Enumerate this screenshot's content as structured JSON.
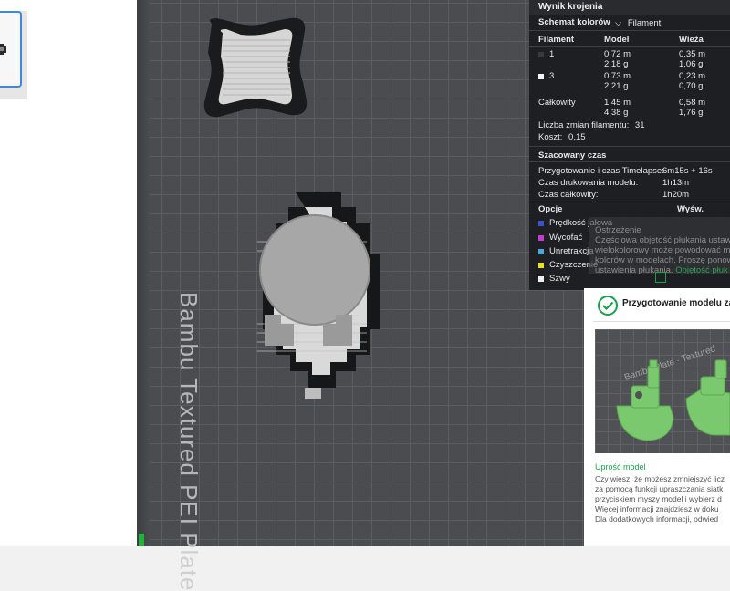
{
  "plate": {
    "label": "Bambu Textured PEI Plate"
  },
  "slice_panel": {
    "title": "Wynik krojenia",
    "color_scheme_label": "Schemat kolorów",
    "color_scheme_value": "Filament",
    "columns": [
      "Filament",
      "Model",
      "Wieża"
    ],
    "filaments": [
      {
        "id": "1",
        "color": "#3a3a3a",
        "model_m": "0,72 m",
        "model_g": "2,18 g",
        "tower_m": "0,35 m",
        "tower_g": "1,06 g"
      },
      {
        "id": "3",
        "color": "#f4f4f4",
        "model_m": "0,73 m",
        "model_g": "2,21 g",
        "tower_m": "0,23 m",
        "tower_g": "0,70 g"
      }
    ],
    "total": {
      "label": "Całkowity",
      "model_m": "1,45 m",
      "model_g": "4,38 g",
      "tower_m": "0,58 m",
      "tower_g": "1,76 g"
    },
    "filament_changes_label": "Liczba zmian filamentu:",
    "filament_changes_value": "31",
    "cost_label": "Koszt:",
    "cost_value": "0,15",
    "time_section": "Szacowany czas",
    "prep_label": "Przygotowanie i czas Timelapse:",
    "prep_value": "6m15s + 16s",
    "print_label": "Czas drukowania modelu:",
    "print_value": "1h13m",
    "total_time_label": "Czas całkowity:",
    "total_time_value": "1h20m",
    "options_label": "Opcje",
    "display_label": "Wyśw.",
    "options": [
      {
        "label": "Prędkość jałowa",
        "color": "#3a52c9"
      },
      {
        "label": "Wycofać",
        "color": "#c43bd1"
      },
      {
        "label": "Unretrakcja",
        "color": "#4aa8d8"
      },
      {
        "label": "Czyszczenie",
        "color": "#e6e02a"
      },
      {
        "label": "Szwy",
        "color": "#eeeeee"
      }
    ]
  },
  "warning": {
    "title": "Ostrzeżenie",
    "lines": [
      "Częściowa objętość płukania ustawio",
      "wielokolorowy może powodować m",
      "kolorów w modelach. Proszę ponow",
      "ustawienia płukania."
    ],
    "link": "Objętość płuk"
  },
  "notification": {
    "title": "Przygotowanie modelu zako",
    "image_text": "Bambu Plate · Textured",
    "tip_title": "Uprość model",
    "tip_lines": [
      "Czy wiesz, że możesz zmniejszyć licz",
      "za pomocą funkcji upraszczania siatk",
      "przyciskiem myszy model i wybierz d",
      "Więcej informacji znajdziesz w doku",
      "Dla dodatkowych informacji, odwied"
    ]
  },
  "colors": {
    "accent": "#3f8ad8",
    "success": "#15a34a",
    "bed": "#4a4c50"
  }
}
